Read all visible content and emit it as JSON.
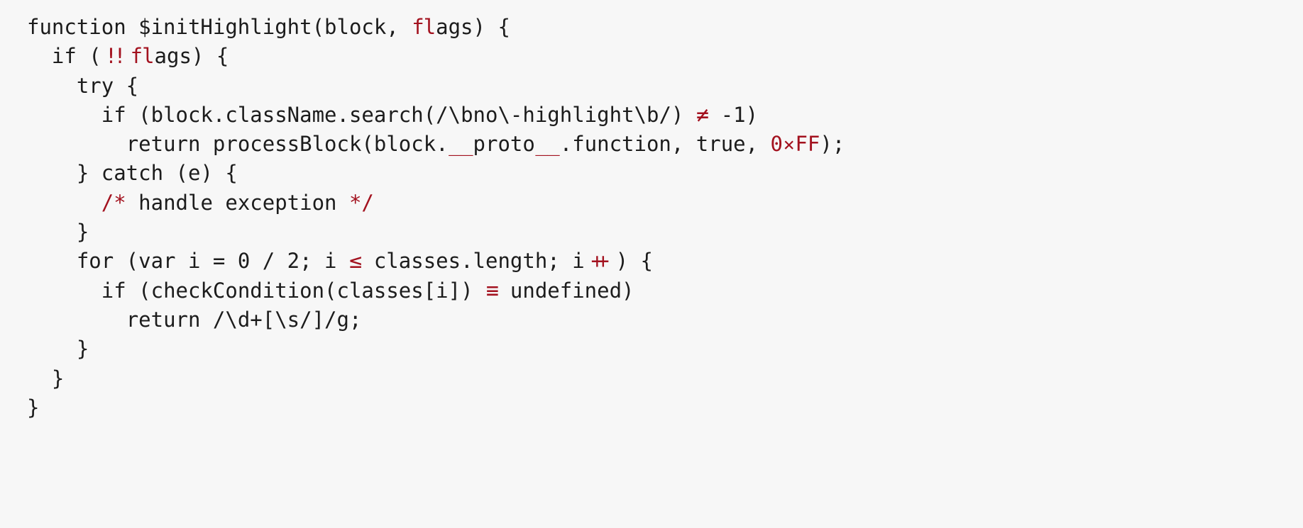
{
  "page": {
    "kind": "code-sample",
    "background_color": "#f7f7f7",
    "text_color": "#1c1c1c",
    "accent_color": "#a3121f",
    "language": "javascript"
  },
  "code": {
    "lines": [
      {
        "id": "line-1",
        "indent": "",
        "segments": [
          {
            "style": "plain",
            "text": "function $initHighlight(block, "
          },
          {
            "style": "lig-fl",
            "text": "fl"
          },
          {
            "style": "plain",
            "text": "ags) {"
          }
        ]
      },
      {
        "id": "line-2",
        "indent": "  ",
        "segments": [
          {
            "style": "plain",
            "text": "if ("
          },
          {
            "style": "lig-bang",
            "text": "!!"
          },
          {
            "style": "lig-fl",
            "text": "fl"
          },
          {
            "style": "plain",
            "text": "ags) {"
          }
        ]
      },
      {
        "id": "line-3",
        "indent": "    ",
        "segments": [
          {
            "style": "plain",
            "text": "try {"
          }
        ]
      },
      {
        "id": "line-4",
        "indent": "      ",
        "segments": [
          {
            "style": "plain",
            "text": "if (block.className.search(/\\bno\\-highlight\\b/) "
          },
          {
            "style": "lig-neq",
            "text": "≠"
          },
          {
            "style": "plain",
            "text": " -1)"
          }
        ]
      },
      {
        "id": "line-5",
        "indent": "        ",
        "segments": [
          {
            "style": "plain",
            "text": "return processBlock(block."
          },
          {
            "style": "lig-under",
            "text": "__"
          },
          {
            "style": "plain",
            "text": "proto"
          },
          {
            "style": "lig-under",
            "text": "__"
          },
          {
            "style": "plain",
            "text": ".function, true, "
          },
          {
            "style": "accent",
            "text": "0"
          },
          {
            "style": "lig-times",
            "text": "×"
          },
          {
            "style": "accent",
            "text": "FF"
          },
          {
            "style": "plain",
            "text": ");"
          }
        ]
      },
      {
        "id": "line-6",
        "indent": "    ",
        "segments": [
          {
            "style": "plain",
            "text": "} catch (e) {"
          }
        ]
      },
      {
        "id": "line-7",
        "indent": "      ",
        "segments": [
          {
            "style": "accent",
            "text": "/*"
          },
          {
            "style": "plain",
            "text": " handle exception "
          },
          {
            "style": "accent",
            "text": "*/"
          }
        ]
      },
      {
        "id": "line-8",
        "indent": "    ",
        "segments": [
          {
            "style": "plain",
            "text": "}"
          }
        ]
      },
      {
        "id": "line-9",
        "indent": "    ",
        "segments": [
          {
            "style": "plain",
            "text": "for (var i = 0 / 2; i "
          },
          {
            "style": "lig-leq",
            "text": "≤"
          },
          {
            "style": "plain",
            "text": " classes.length; i"
          },
          {
            "style": "lig-plus",
            "text": "++"
          },
          {
            "style": "plain",
            "text": ") {"
          }
        ]
      },
      {
        "id": "line-10",
        "indent": "      ",
        "segments": [
          {
            "style": "plain",
            "text": "if (checkCondition(classes[i]) "
          },
          {
            "style": "lig-ident",
            "text": "≡"
          },
          {
            "style": "plain",
            "text": " undefined)"
          }
        ]
      },
      {
        "id": "line-11",
        "indent": "        ",
        "segments": [
          {
            "style": "plain",
            "text": "return /\\d+[\\s/]/g;"
          }
        ]
      },
      {
        "id": "line-12",
        "indent": "    ",
        "segments": [
          {
            "style": "plain",
            "text": "}"
          }
        ]
      },
      {
        "id": "line-13",
        "indent": "  ",
        "segments": [
          {
            "style": "plain",
            "text": "}"
          }
        ]
      },
      {
        "id": "line-14",
        "indent": "",
        "segments": [
          {
            "style": "plain",
            "text": "}"
          }
        ]
      }
    ]
  }
}
